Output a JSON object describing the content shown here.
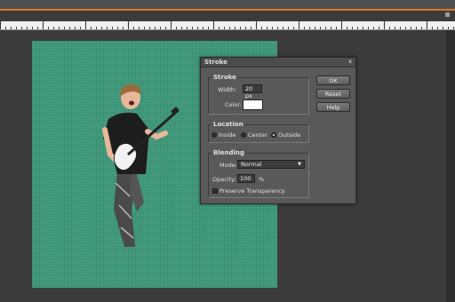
{
  "dialog": {
    "title": "Stroke",
    "close_glyph": "x",
    "stroke": {
      "label": "Stroke",
      "width_label": "Width:",
      "width_value": "20 px",
      "color_label": "Color:",
      "color_value": "#ffffff"
    },
    "location": {
      "label": "Location",
      "options": [
        "Inside",
        "Center",
        "Outside"
      ],
      "selected": "Outside"
    },
    "blending": {
      "label": "Blending",
      "mode_label": "Mode:",
      "mode_value": "Normal",
      "opacity_label": "Opacity:",
      "opacity_value": "100",
      "opacity_unit": "%",
      "preserve_label": "Preserve Transparency"
    },
    "buttons": {
      "ok": "OK",
      "reset": "Reset",
      "help": "Help"
    }
  },
  "colors": {
    "canvas": "#3f9779",
    "accent": "#d9772b"
  }
}
